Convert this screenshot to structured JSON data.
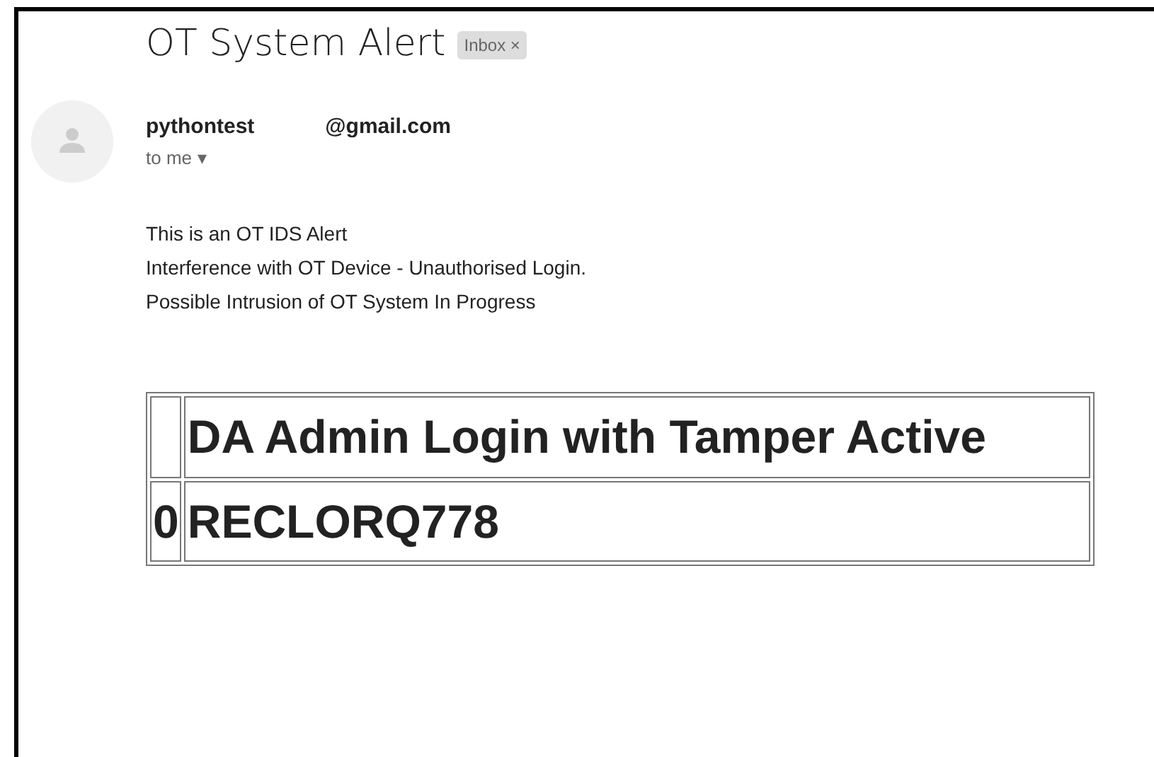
{
  "subject": "OT System Alert",
  "label": {
    "text": "Inbox",
    "close": "×"
  },
  "sender": {
    "name": "pythontest",
    "address": "@gmail.com",
    "recipient": "to me",
    "caret": "▾"
  },
  "body": [
    "This is an OT IDS Alert",
    "Interference with OT Device - Unauthorised Login.",
    "Possible Intrusion of OT System In Progress"
  ],
  "table": {
    "columns": [
      "",
      "DA Admin Login with Tamper Active"
    ],
    "rows": [
      [
        "0",
        "RECLORQ778"
      ]
    ]
  }
}
